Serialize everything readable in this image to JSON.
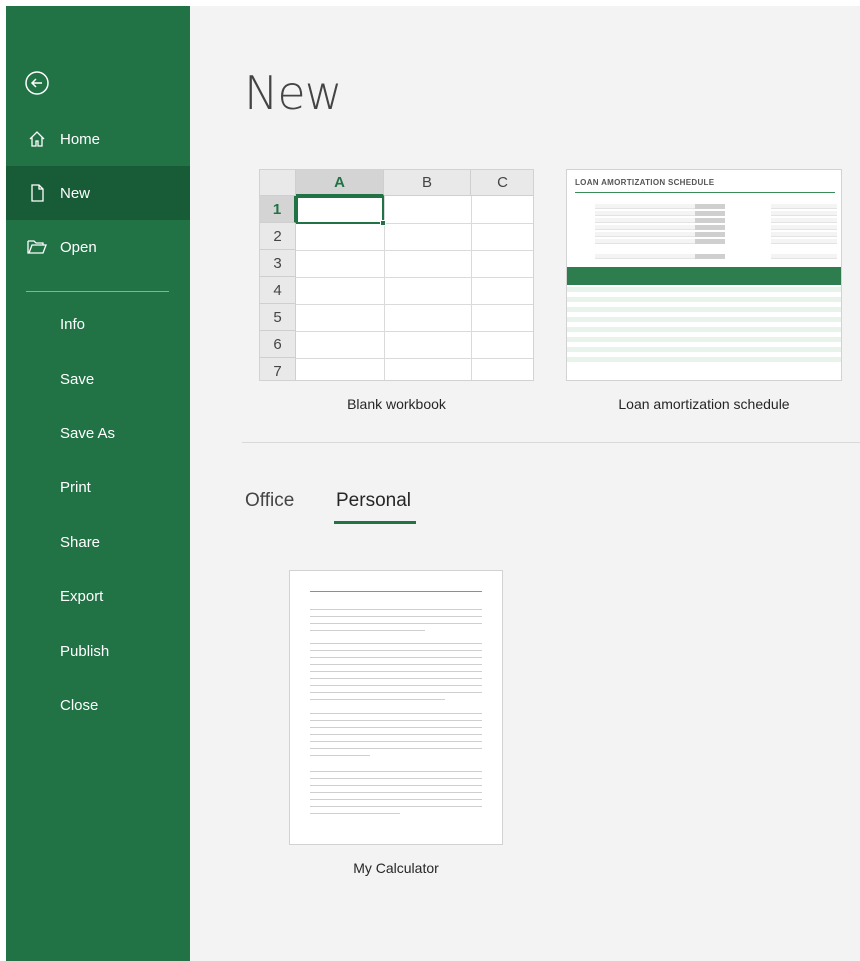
{
  "sidebar": {
    "back_icon": "circle-arrow-left-icon",
    "items": [
      {
        "label": "Home",
        "icon": "home-icon"
      },
      {
        "label": "New",
        "icon": "new-document-icon",
        "active": true
      },
      {
        "label": "Open",
        "icon": "open-folder-icon"
      },
      {
        "label": "Info"
      },
      {
        "label": "Save"
      },
      {
        "label": "Save As"
      },
      {
        "label": "Print"
      },
      {
        "label": "Share"
      },
      {
        "label": "Export"
      },
      {
        "label": "Publish"
      },
      {
        "label": "Close"
      }
    ],
    "bg_color": "#217346",
    "active_color": "#185c37"
  },
  "main": {
    "title": "New",
    "templates": [
      {
        "label": "Blank workbook",
        "columns": [
          "A",
          "B",
          "C"
        ],
        "rows": [
          "1",
          "2",
          "3",
          "4",
          "5",
          "6",
          "7"
        ]
      },
      {
        "label": "Loan amortization schedule",
        "preview_title": "LOAN AMORTIZATION SCHEDULE"
      }
    ],
    "tabs": [
      {
        "label": "Office"
      },
      {
        "label": "Personal",
        "active": true
      }
    ],
    "personal_templates": [
      {
        "label": "My Calculator"
      }
    ]
  }
}
